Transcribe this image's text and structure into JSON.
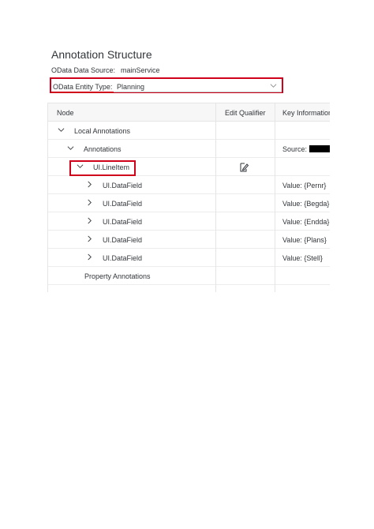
{
  "page": {
    "title": "Annotation Structure",
    "data_source_label": "OData Data Source:",
    "data_source_value": "mainService",
    "entity_type_label": "OData Entity Type:",
    "entity_type_value": "Planning"
  },
  "table": {
    "headers": {
      "node": "Node",
      "edit_qualifier": "Edit Qualifier",
      "key_information": "Key Information"
    },
    "rows": [
      {
        "label": "Local Annotations",
        "key": ""
      },
      {
        "label": "Annotations",
        "key": "Source:"
      },
      {
        "label": "UI.LineItem",
        "key": ""
      },
      {
        "label": "UI.DataField",
        "key": "Value: {Pernr}"
      },
      {
        "label": "UI.DataField",
        "key": "Value: {Begda}"
      },
      {
        "label": "UI.DataField",
        "key": "Value: {Endda}"
      },
      {
        "label": "UI.DataField",
        "key": "Value: {Plans}"
      },
      {
        "label": "UI.DataField",
        "key": "Value: {Stell}"
      },
      {
        "label": "Property Annotations",
        "key": ""
      }
    ]
  },
  "icons": {
    "expand": "chevron-down-icon",
    "collapse": "chevron-right-icon",
    "edit": "edit-qualifier-icon"
  },
  "colors": {
    "highlight": "#d0021b"
  }
}
